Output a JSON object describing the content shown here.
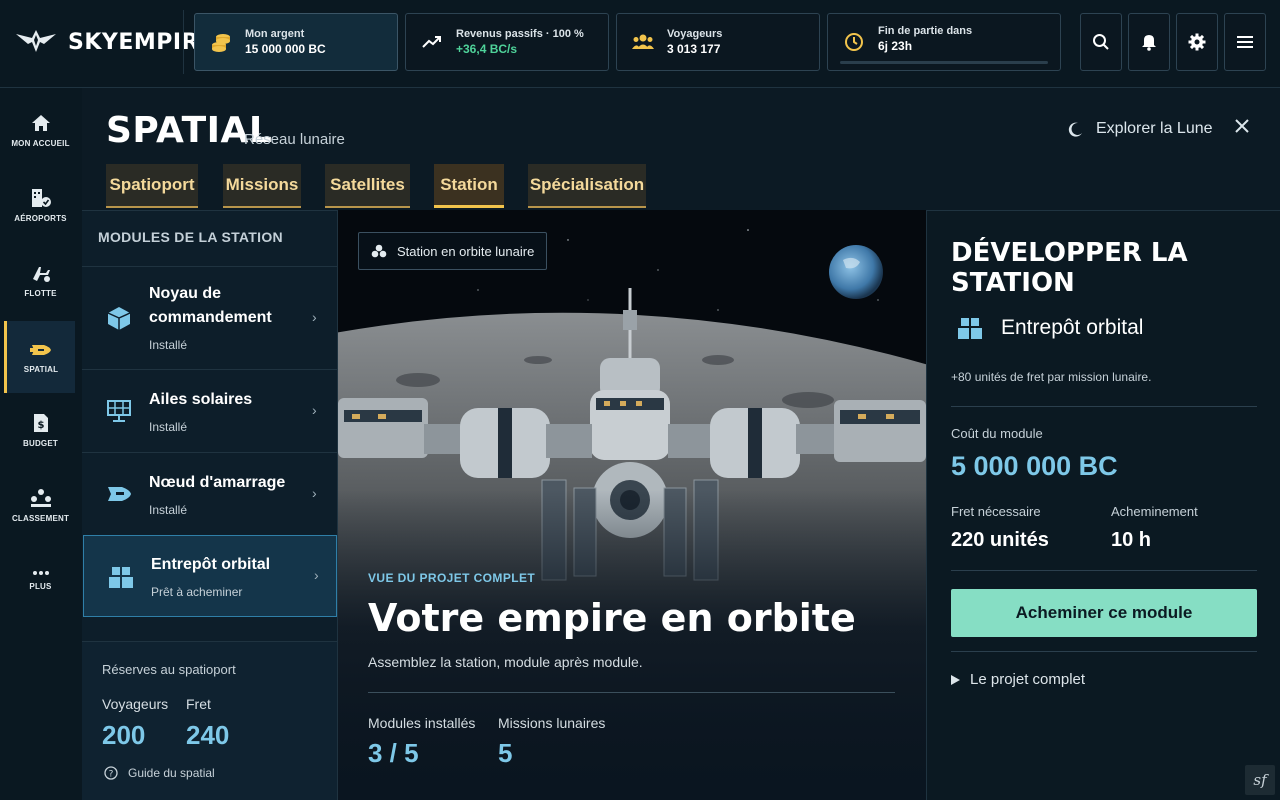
{
  "app": {
    "name": "SKYEMPIRE"
  },
  "stats": {
    "money": {
      "label": "Mon argent",
      "value": "15 000 000 BC",
      "icon": "coins-icon"
    },
    "income": {
      "label": "Revenus passifs · 100 %",
      "value": "+36,4 BC/s",
      "icon": "trend-up-icon"
    },
    "travelers": {
      "label": "Voyageurs",
      "value": "3 013 177",
      "icon": "users-icon"
    },
    "endgame": {
      "label": "Fin de partie dans",
      "value": "6j 23h",
      "icon": "clock-icon"
    }
  },
  "nav": [
    {
      "label": "MON ACCUEIL",
      "icon": "home-icon"
    },
    {
      "label": "AÉROPORTS",
      "icon": "airport-icon"
    },
    {
      "label": "FLOTTE",
      "icon": "plane-icon"
    },
    {
      "label": "SPATIAL",
      "icon": "shuttle-icon",
      "active": true
    },
    {
      "label": "BUDGET",
      "icon": "budget-icon"
    },
    {
      "label": "CLASSEMENT",
      "icon": "ranking-icon"
    },
    {
      "label": "PLUS",
      "icon": "more-icon"
    }
  ],
  "header": {
    "title": "SPATIAL",
    "subtitle": "Réseau lunaire",
    "explore": "Explorer la Lune"
  },
  "tabs": [
    "Spatioport",
    "Missions",
    "Satellites",
    "Station",
    "Spécialisation"
  ],
  "active_tab": "Station",
  "modules": {
    "heading": "MODULES DE LA STATION",
    "items": [
      {
        "name": "Noyau de commandement",
        "status": "Installé",
        "icon": "cube-icon"
      },
      {
        "name": "Ailes solaires",
        "status": "Installé",
        "icon": "solar-panel-icon"
      },
      {
        "name": "Nœud d'amarrage",
        "status": "Installé",
        "icon": "docking-icon"
      },
      {
        "name": "Entrepôt orbital",
        "status": "Prêt à acheminer",
        "icon": "boxes-icon",
        "active": true
      }
    ]
  },
  "reserves": {
    "title": "Réserves au spatioport",
    "travelers_label": "Voyageurs",
    "travelers_value": "200",
    "freight_label": "Fret",
    "freight_value": "240",
    "guide": "Guide du spatial"
  },
  "scene": {
    "badge": "Station en orbite lunaire",
    "eyebrow": "VUE DU PROJET COMPLET",
    "title": "Votre empire en orbite",
    "subtitle": "Assemblez la station, module après module.",
    "installed_label": "Modules installés",
    "installed_value": "3 / 5",
    "missions_label": "Missions lunaires",
    "missions_value": "5"
  },
  "develop": {
    "title": "DÉVELOPPER LA STATION",
    "module_name": "Entrepôt orbital",
    "description": "+80 unités de fret par mission lunaire.",
    "cost_label": "Coût du module",
    "cost_value": "5 000 000 BC",
    "freight_label": "Fret nécessaire",
    "freight_value": "220 unités",
    "routing_label": "Acheminement",
    "routing_value": "10 h",
    "button": "Acheminer ce module",
    "project_link": "Le projet complet"
  },
  "colors": {
    "accent_gold": "#f2c44c",
    "accent_blue": "#7ec8e8",
    "accent_green": "#4fd39a",
    "button_mint": "#86dec4"
  }
}
